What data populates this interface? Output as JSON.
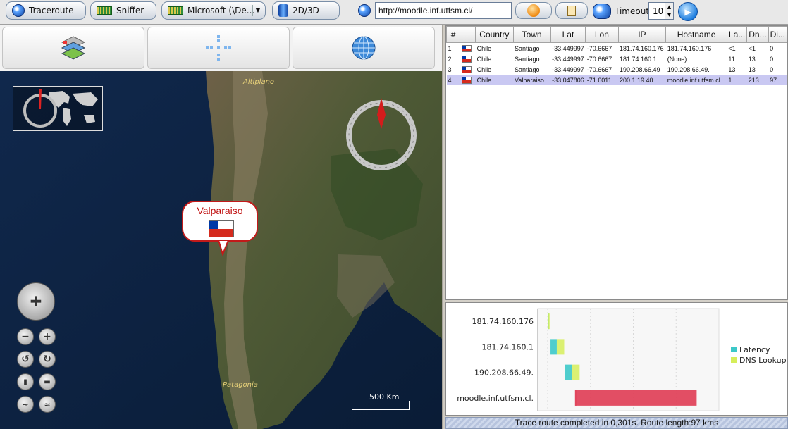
{
  "toolbar": {
    "traceroute_label": "Traceroute",
    "sniffer_label": "Sniffer",
    "adapter_label": "Microsoft (\\De...",
    "view_toggle_label": "2D/3D",
    "url_value": "http://moodle.inf.utfsm.cl/",
    "timeout_label": "Timeout",
    "timeout_value": "10"
  },
  "map": {
    "labels": {
      "altiplano": "Altiplano",
      "patagonia": "Patagonia"
    },
    "balloon_title": "Valparaiso",
    "scale_label": "500 Km"
  },
  "table": {
    "headers": [
      "#",
      "",
      "Country",
      "Town",
      "Lat",
      "Lon",
      "IP",
      "Hostname",
      "La...",
      "Dn...",
      "Di..."
    ],
    "rows": [
      {
        "n": "1",
        "country": "Chile",
        "town": "Santiago",
        "lat": "-33.449997",
        "lon": "-70.6667",
        "ip": "181.74.160.176",
        "host": "181.74.160.176",
        "lat_ms": "<1",
        "dns": "<1",
        "dist": "0"
      },
      {
        "n": "2",
        "country": "Chile",
        "town": "Santiago",
        "lat": "-33.449997",
        "lon": "-70.6667",
        "ip": "181.74.160.1",
        "host": "(None)",
        "lat_ms": "11",
        "dns": "13",
        "dist": "0"
      },
      {
        "n": "3",
        "country": "Chile",
        "town": "Santiago",
        "lat": "-33.449997",
        "lon": "-70.6667",
        "ip": "190.208.66.49",
        "host": "190.208.66.49.",
        "lat_ms": "13",
        "dns": "13",
        "dist": "0"
      },
      {
        "n": "4",
        "country": "Chile",
        "town": "Valparaiso",
        "lat": "-33.047806",
        "lon": "-71.6011",
        "ip": "200.1.19.40",
        "host": "moodle.inf.utfsm.cl.",
        "lat_ms": "1",
        "dns": "213",
        "dist": "97"
      }
    ]
  },
  "chart_data": {
    "type": "bar",
    "orientation": "horizontal-gantt",
    "categories": [
      "181.74.160.176",
      "181.74.160.1",
      "190.208.66.49.",
      "moodle.inf.utfsm.cl."
    ],
    "series": [
      {
        "name": "Latency",
        "color": "#3cc8c8",
        "values": [
          1,
          11,
          13,
          1
        ]
      },
      {
        "name": "DNS Lookup",
        "color": "#d6ee5a",
        "values": [
          1,
          13,
          13,
          213
        ]
      }
    ],
    "starts": [
      0,
      5,
      30,
      48
    ],
    "grid": true,
    "legend": "right"
  },
  "status": {
    "text": "Trace route completed in 0,301s. Route length:97 kms"
  },
  "colors": {
    "selection": "#c9c8f2",
    "final_hop_bar": "#e0445c",
    "balloon_border": "#c21a1a"
  }
}
